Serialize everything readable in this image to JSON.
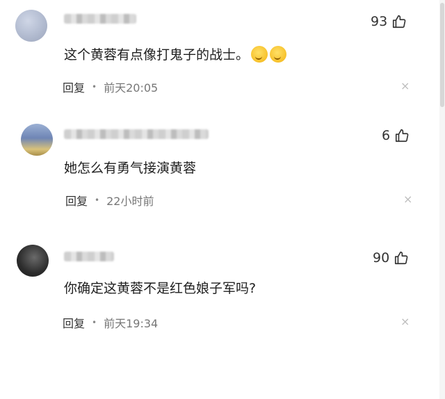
{
  "comments": [
    {
      "likes": "93",
      "text": "这个黄蓉有点像打鬼子的战士。",
      "emojis": 2,
      "reply": "回复",
      "time": "前天20:05",
      "close": "×"
    },
    {
      "likes": "6",
      "text": "她怎么有勇气接演黄蓉",
      "emojis": 0,
      "reply": "回复",
      "time": "22小时前",
      "close": "×"
    },
    {
      "likes": "90",
      "text": "你确定这黄蓉不是红色娘子军吗?",
      "emojis": 0,
      "reply": "回复",
      "time": "前天19:34",
      "close": "×"
    }
  ],
  "icons": {
    "like": "thumbs-up-icon",
    "close": "close-icon"
  },
  "colors": {
    "text": "#1e1e1e",
    "meta": "#777777",
    "close": "#bdbdbd"
  }
}
